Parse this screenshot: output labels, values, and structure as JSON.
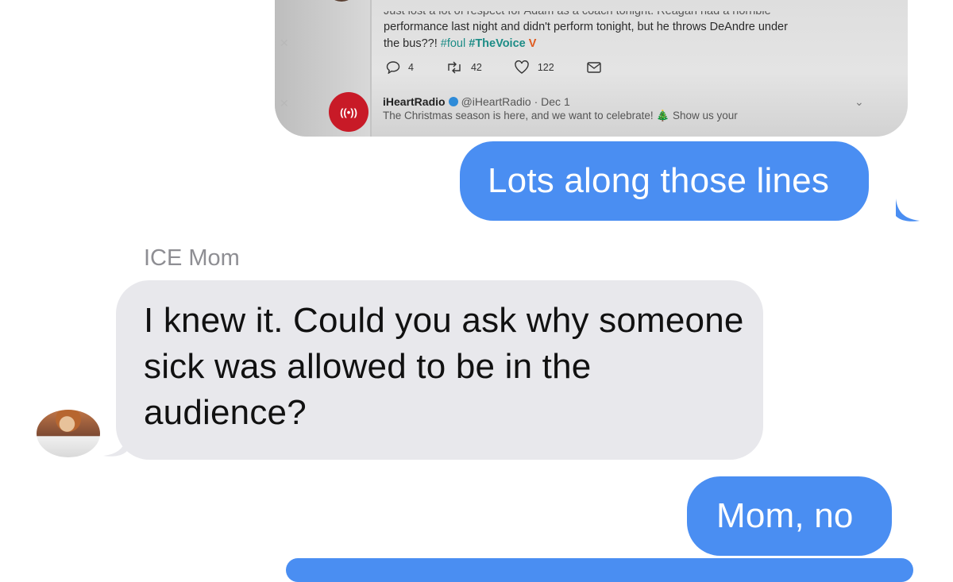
{
  "tweet1": {
    "line_cut": "Just lost a lot of respect for Adam as a coach tonight. Reagan had a horrible",
    "line2": "performance last night and didn't perform tonight, but he throws DeAndre under",
    "line3_text": "the bus??!",
    "hashtag1": "#foul",
    "hashtag2": "#TheVoice",
    "replies": "4",
    "retweets": "42",
    "likes": "122"
  },
  "tweet2": {
    "name": "iHeartRadio",
    "handle": "@iHeartRadio · Dec 1",
    "text": "The Christmas season is here, and we want to celebrate! 🎄 Show us your"
  },
  "messages": [
    {
      "text": "Lots along those lines"
    },
    {
      "sender": "ICE Mom",
      "text": "I knew it. Could you ask why someone sick was allowed to be in the audience?"
    },
    {
      "text": "Mom, no"
    }
  ],
  "colors": {
    "outgoing": "#4a8ef2",
    "incoming": "#e8e8ec",
    "sender": "#8e8e93"
  }
}
